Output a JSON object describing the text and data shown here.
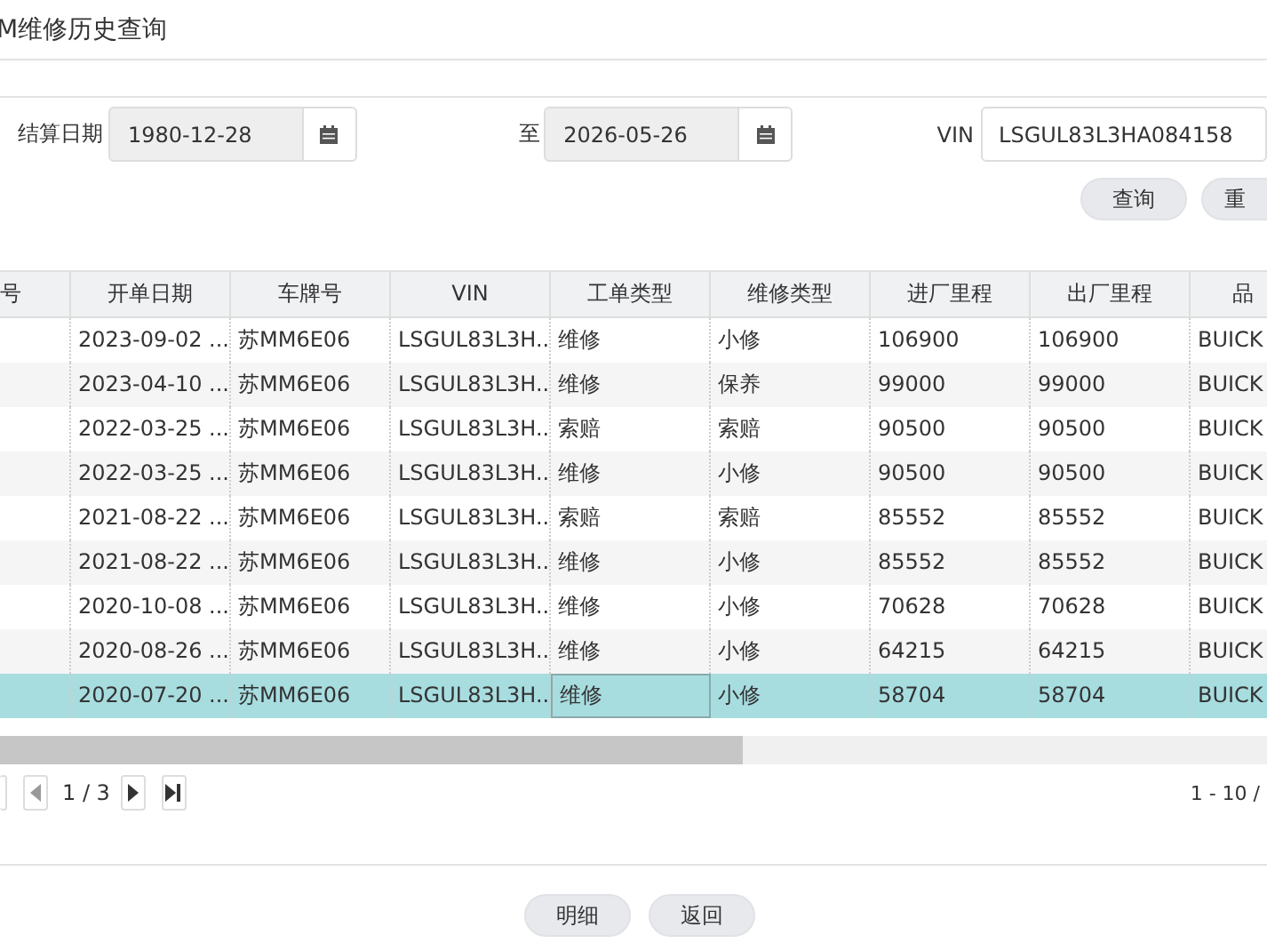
{
  "window": {
    "title": "M维修历史查询"
  },
  "filters": {
    "date_label": "结算日期",
    "date_from": "1980-12-28",
    "to_label": "至",
    "date_to": "2026-05-26",
    "vin_label": "VIN",
    "vin": "LSGUL83L3HA084158"
  },
  "buttons": [
    "查询",
    "重"
  ],
  "table": {
    "columns": [
      "号",
      "开单日期",
      "车牌号",
      "VIN",
      "工单类型",
      "维修类型",
      "进厂里程",
      "出厂里程",
      "品"
    ],
    "rows": [
      {
        "selected": false,
        "cells": [
          "",
          "2023-09-02 ...",
          "苏MM6E06",
          "LSGUL83L3H...",
          "维修",
          "小修",
          "106900",
          "106900",
          "BUICK"
        ]
      },
      {
        "selected": false,
        "cells": [
          "",
          "2023-04-10 ...",
          "苏MM6E06",
          "LSGUL83L3H...",
          "维修",
          "保养",
          "99000",
          "99000",
          "BUICK"
        ]
      },
      {
        "selected": false,
        "cells": [
          "",
          "2022-03-25 ...",
          "苏MM6E06",
          "LSGUL83L3H...",
          "索赔",
          "索赔",
          "90500",
          "90500",
          "BUICK"
        ]
      },
      {
        "selected": false,
        "cells": [
          "",
          "2022-03-25 ...",
          "苏MM6E06",
          "LSGUL83L3H...",
          "维修",
          "小修",
          "90500",
          "90500",
          "BUICK"
        ]
      },
      {
        "selected": false,
        "cells": [
          "",
          "2021-08-22 ...",
          "苏MM6E06",
          "LSGUL83L3H...",
          "索赔",
          "索赔",
          "85552",
          "85552",
          "BUICK"
        ]
      },
      {
        "selected": false,
        "cells": [
          "",
          "2021-08-22 ...",
          "苏MM6E06",
          "LSGUL83L3H...",
          "维修",
          "小修",
          "85552",
          "85552",
          "BUICK"
        ]
      },
      {
        "selected": false,
        "cells": [
          "",
          "2020-10-08 ...",
          "苏MM6E06",
          "LSGUL83L3H...",
          "维修",
          "小修",
          "70628",
          "70628",
          "BUICK"
        ]
      },
      {
        "selected": false,
        "cells": [
          "",
          "2020-08-26 ...",
          "苏MM6E06",
          "LSGUL83L3H...",
          "维修",
          "小修",
          "64215",
          "64215",
          "BUICK"
        ]
      },
      {
        "selected": true,
        "cells": [
          "",
          "2020-07-20 ...",
          "苏MM6E06",
          "LSGUL83L3H...",
          "维修",
          "小修",
          "58704",
          "58704",
          "BUICK"
        ]
      }
    ]
  },
  "pager": {
    "page": "1 / 3",
    "range": "1 - 10 /"
  },
  "footer_buttons": [
    "明细",
    "返回"
  ]
}
